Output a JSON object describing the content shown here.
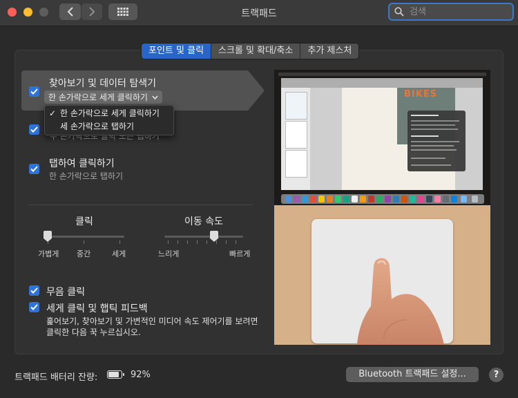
{
  "window": {
    "title": "트랙패드"
  },
  "search": {
    "placeholder": "검색"
  },
  "tabs": [
    {
      "label": "포인트 및 클릭",
      "active": true
    },
    {
      "label": "스크롤 및 확대/축소",
      "active": false
    },
    {
      "label": "추가 제스처",
      "active": false
    }
  ],
  "options": {
    "lookup": {
      "title": "찾아보기 및 데이터 탐색기",
      "selected": "한 손가락으로 세게 클릭하기",
      "checked": true
    },
    "secondary": {
      "subtitle_partial": "두 손가락으로 클릭 또는 탭하기",
      "checked": true
    },
    "tap": {
      "title": "탭하여 클릭하기",
      "subtitle": "한 손가락으로 탭하기",
      "checked": true
    }
  },
  "dropdown_menu": {
    "items": [
      {
        "label": "한 손가락으로 세게 클릭하기",
        "checked": true
      },
      {
        "label": "세 손가락으로 탭하기",
        "checked": false
      }
    ]
  },
  "sliders": {
    "click": {
      "title": "클릭",
      "labels": [
        "가볍게",
        "중간",
        "세게"
      ],
      "value_fraction": 0.0
    },
    "speed": {
      "title": "이동 속도",
      "labels": [
        "느리게",
        "빠르게"
      ],
      "value_fraction": 0.64
    }
  },
  "silent_click": {
    "label": "무음 클릭",
    "checked": true
  },
  "force_click": {
    "label": "세게 클릭 및 햅틱 피드백",
    "description": "훑어보기, 찾아보기 및 가변적인 미디어 속도 제어기를 보려면 클릭한 다음 꾹 누르십시오.",
    "checked": true
  },
  "preview": {
    "doc_title": "BIKES"
  },
  "footer": {
    "battery_label": "트랙패드 배터리 잔량:",
    "battery_percent": "92%",
    "battery_level": 0.92,
    "bluetooth_button": "Bluetooth 트랙패드 설정...",
    "help_label": "?"
  },
  "colors": {
    "accent": "#2f73d8",
    "tab_active": "#2765c9"
  }
}
